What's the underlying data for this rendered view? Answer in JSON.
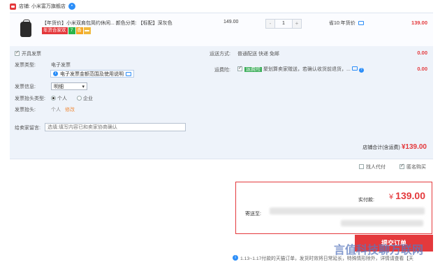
{
  "store": {
    "label": "店铺: 小米富万旗舰店"
  },
  "item": {
    "title": "【年货价】小米双肩包简约休闲... 颜色分类: 【标配】深灰色",
    "badges": [
      "年货合家欢",
      "7",
      "香"
    ],
    "unit_price": "149.00",
    "quantity": "1",
    "qty_minus": "-",
    "qty_plus": "+",
    "discount": "省10:年货价",
    "subtotal": "139.00"
  },
  "invoice": {
    "open_label": "开具发票",
    "type_label": "发票类型:",
    "type_value": "电子发票",
    "type_info": "电子发票金额范围及使用说明",
    "info_label": "发票信息:",
    "info_value": "明细",
    "title_type_label": "发票抬头类型:",
    "personal": "个人",
    "company": "企业",
    "title_label": "发票抬头:",
    "title_value": "个人",
    "edit": "修改"
  },
  "delivery": {
    "label": "运送方式:",
    "value": "普通配送 快递 免邮",
    "amount": "0.00",
    "insurance_label": "运费险:",
    "insurance_tag": "运费险",
    "insurance_text": "聚划算卖家赠送，若确认收货前退货，...",
    "insurance_amount": "0.00"
  },
  "note": {
    "label": "给卖家留言:",
    "placeholder": "选填:填写内容已和卖家协商确认"
  },
  "store_total": {
    "label": "店铺合计(含运费)",
    "amount": "¥139.00"
  },
  "options": {
    "proxy_pay": "找人代付",
    "anonymous": "匿名购买"
  },
  "payment": {
    "label": "实付款:",
    "currency": "¥",
    "amount": "139.00",
    "ship_to": "寄送至:"
  },
  "submit": {
    "label": "提交订单"
  },
  "watermark": "言值科技聊万联网",
  "footer_tip": "1.13~1.17付款的天猫订单，发货时效将日常延长，特殊情形除外，详情请查看【天"
}
